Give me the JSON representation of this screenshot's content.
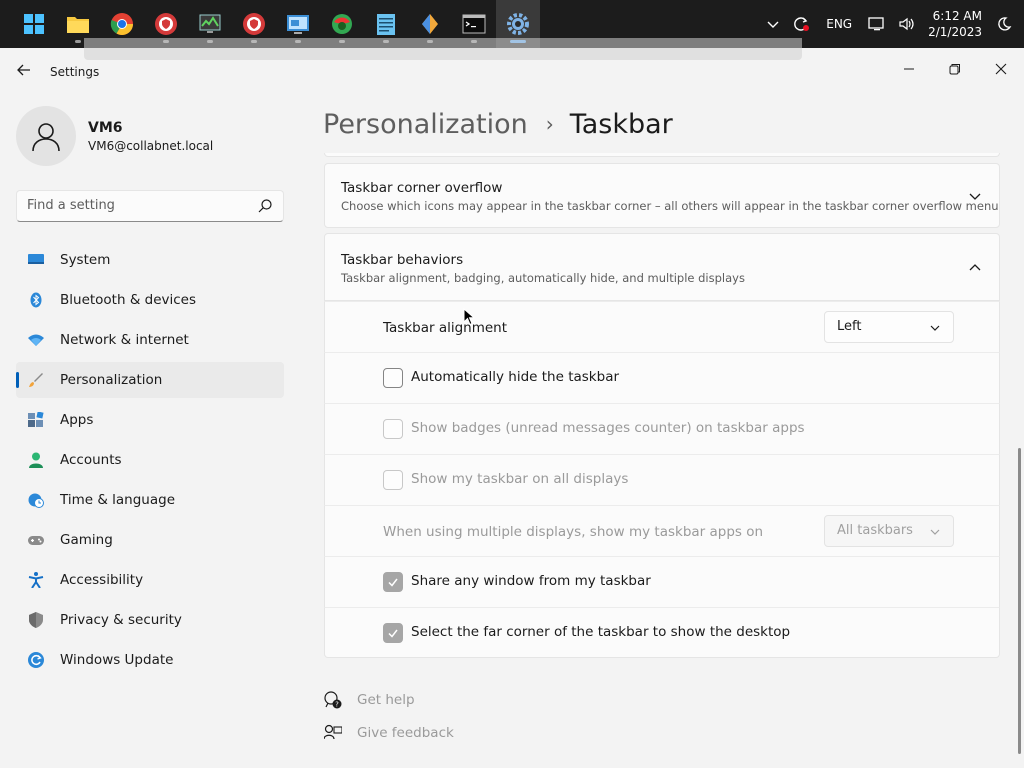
{
  "taskbar": {
    "apps": [
      {
        "name": "start-icon",
        "color": "#4cc2ff"
      },
      {
        "name": "file-explorer-icon",
        "color": "#f7c940"
      },
      {
        "name": "chrome-icon",
        "color": "#e34133"
      },
      {
        "name": "shield-browser-icon",
        "color": "#d43a3a"
      },
      {
        "name": "monitor-app-icon",
        "color": "#4a7f3f"
      },
      {
        "name": "shield-browser-2-icon",
        "color": "#d43a3a"
      },
      {
        "name": "remote-desktop-icon",
        "color": "#3c8fd6"
      },
      {
        "name": "colorful-app-icon",
        "color": "#32a852"
      },
      {
        "name": "notepad-icon",
        "color": "#6ac2f0"
      },
      {
        "name": "feather-app-icon",
        "color": "#f2a83b"
      },
      {
        "name": "terminal-icon",
        "color": "#0c0c0c"
      },
      {
        "name": "settings-gear-icon",
        "color": "#7fb3e6"
      }
    ],
    "tray": {
      "lang": "ENG",
      "time": "6:12 AM",
      "date": "2/1/2023"
    }
  },
  "window": {
    "title": "Settings"
  },
  "profile": {
    "name": "VM6",
    "email": "VM6@collabnet.local"
  },
  "search": {
    "placeholder": "Find a setting"
  },
  "nav": {
    "items": [
      {
        "label": "System",
        "icon": "monitor-icon"
      },
      {
        "label": "Bluetooth & devices",
        "icon": "bluetooth-icon"
      },
      {
        "label": "Network & internet",
        "icon": "wifi-icon"
      },
      {
        "label": "Personalization",
        "icon": "brush-icon"
      },
      {
        "label": "Apps",
        "icon": "apps-icon"
      },
      {
        "label": "Accounts",
        "icon": "person-icon"
      },
      {
        "label": "Time & language",
        "icon": "globe-clock-icon"
      },
      {
        "label": "Gaming",
        "icon": "gamepad-icon"
      },
      {
        "label": "Accessibility",
        "icon": "accessibility-icon"
      },
      {
        "label": "Privacy & security",
        "icon": "shield-icon"
      },
      {
        "label": "Windows Update",
        "icon": "update-icon"
      }
    ],
    "selected": "Personalization"
  },
  "breadcrumb": {
    "parent": "Personalization",
    "separator": "›",
    "current": "Taskbar"
  },
  "overflow_card": {
    "title": "Taskbar corner overflow",
    "desc": "Choose which icons may appear in the taskbar corner – all others will appear in the taskbar corner overflow menu"
  },
  "behaviors_card": {
    "title": "Taskbar behaviors",
    "desc": "Taskbar alignment, badging, automatically hide, and multiple displays"
  },
  "settings": {
    "alignment_label": "Taskbar alignment",
    "alignment_value": "Left",
    "auto_hide_label": "Automatically hide the taskbar",
    "badges_label": "Show badges (unread messages counter) on taskbar apps",
    "all_displays_label": "Show my taskbar on all displays",
    "multi_display_label": "When using multiple displays, show my taskbar apps on",
    "multi_display_value": "All taskbars",
    "share_window_label": "Share any window from my taskbar",
    "far_corner_label": "Select the far corner of the taskbar to show the desktop"
  },
  "help": {
    "get_help": "Get help",
    "give_feedback": "Give feedback"
  },
  "colors": {
    "accent": "#005fb8",
    "taskbar_bg": "#1c1c1c",
    "window_bg": "#f3f3f3",
    "card_bg": "#fbfbfb"
  }
}
